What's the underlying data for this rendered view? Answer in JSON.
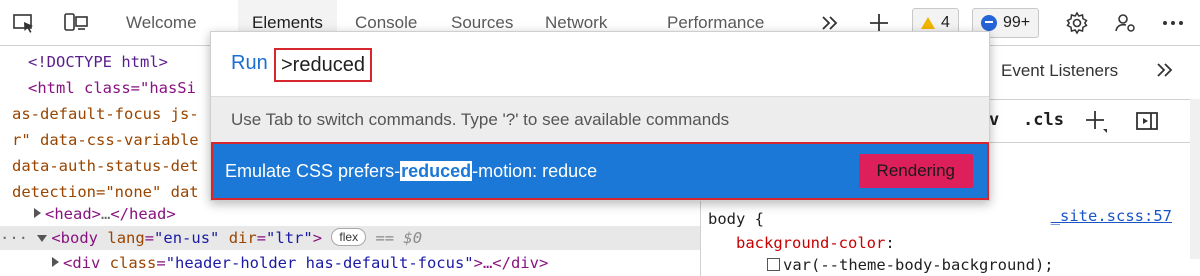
{
  "toolbar": {
    "tabs": [
      "Welcome",
      "Elements",
      "Console",
      "Sources",
      "Network",
      "Performance"
    ],
    "more_tabs_icon": "double-chevron-right-icon",
    "add_tab_icon": "plus-icon",
    "warnings_count": "4",
    "messages_count": "99+",
    "icons": [
      "inspect-icon",
      "device-emulation-icon",
      "settings-icon",
      "customize-icon",
      "more-icon"
    ]
  },
  "dom_tree": {
    "doctype": "<!DOCTYPE html>",
    "html_open": "<html class=\"hasSi",
    "line3": "as-default-focus js-",
    "line4": "r\" data-css-variable",
    "line5": "data-auth-status-det",
    "line6": "detection=\"none\" dat",
    "head_tag": "<head>",
    "head_ellipsis": "…",
    "head_close": "</head>",
    "dots": "···",
    "body_open": "<body",
    "body_attr1_name": "lang",
    "body_attr1_val": "\"en-us\"",
    "body_attr2_name": "dir",
    "body_attr2_val": "\"ltr\"",
    "body_close": ">",
    "flex_badge": "flex",
    "eq_ref": "== $0",
    "div_open": "<div",
    "div_attr_name": "class",
    "div_attr_val": "\"header-holder has-default-focus\"",
    "div_rest": ">…</div>"
  },
  "styles_pane": {
    "tab_event_listeners": "Event Listeners",
    "more_icon": "double-chevron-right-icon",
    "toggle_label": "v",
    "cls_label": ".cls",
    "selector": "body {",
    "source_link": "_site.scss:57",
    "property": "background-color",
    "value": "var(--theme-body-background);"
  },
  "command_menu": {
    "run_label": "Run",
    "query": ">reduced",
    "hint": "Use Tab to switch commands. Type '?' to see available commands",
    "result_prefix": "Emulate CSS prefers-",
    "result_match": "reduced",
    "result_suffix": "-motion: reduce",
    "result_category": "Rendering"
  },
  "colors": {
    "accent_blue": "#1b78d6",
    "highlight_red": "#d6262e",
    "category_pink": "#dd1f5c",
    "warning_yellow": "#f0b400"
  }
}
